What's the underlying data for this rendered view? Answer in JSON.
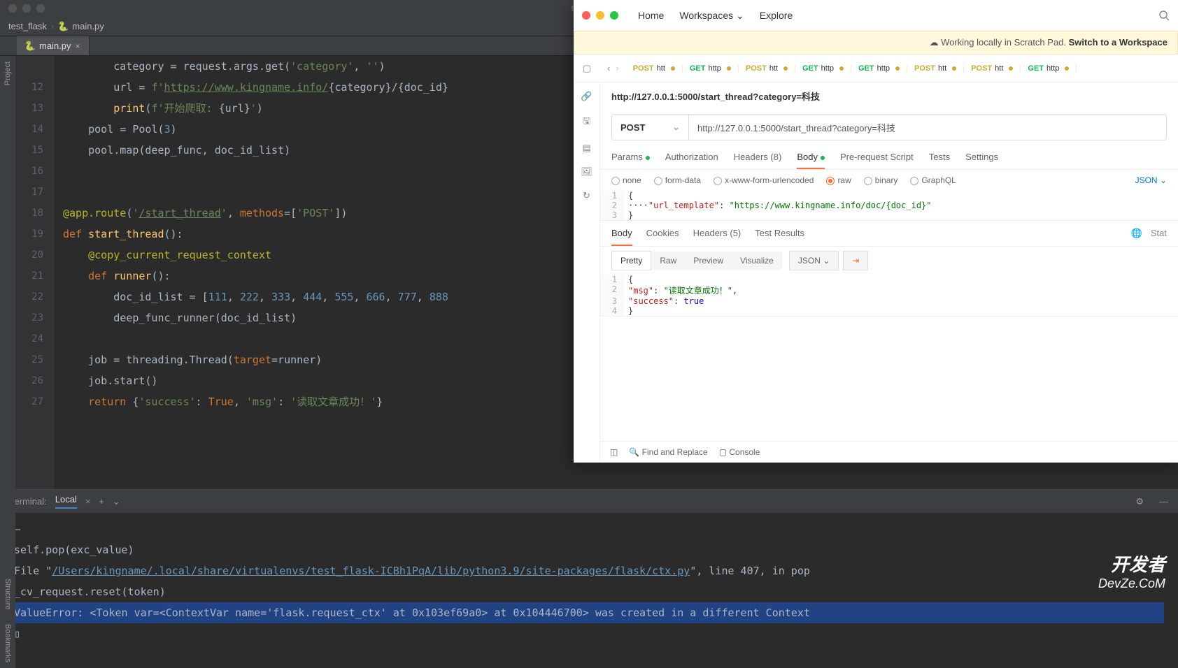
{
  "ide": {
    "title": "test_flask",
    "breadcrumb": {
      "proj": "test_flask",
      "file": "main.py"
    },
    "tab": {
      "file": "main.py"
    },
    "sidebar": {
      "project": "Project",
      "structure": "Structure",
      "bookmarks": "Bookmarks"
    },
    "lines": [
      {
        "n": "",
        "html": "        category = request.args.get(<span class='str'>'category'</span>, <span class='str'>''</span>)"
      },
      {
        "n": "12",
        "html": "        url = <span class='str'>f'</span><span class='link'>https://www.kingname.info/</span><span class='op'>{</span>category<span class='op'>}</span>/<span class='op'>{</span>doc_id<span class='op'>}</span>"
      },
      {
        "n": "13",
        "html": "        <span class='fn'>print</span>(<span class='str'>f'开始爬取: </span><span class='op'>{</span>url<span class='op'>}</span><span class='str'>'</span>)"
      },
      {
        "n": "14",
        "html": "    pool = Pool(<span class='num'>3</span>)"
      },
      {
        "n": "15",
        "html": "    pool.map(deep_func, doc_id_list)"
      },
      {
        "n": "16",
        "html": ""
      },
      {
        "n": "17",
        "html": ""
      },
      {
        "n": "18",
        "html": "<span class='dec'>@app.route</span>(<span class='str'>'</span><span class='link'>/start_thread</span><span class='str'>'</span>, <span class='param'>methods</span>=[<span class='str'>'POST'</span>])"
      },
      {
        "n": "19",
        "html": "<span class='kw'>def </span><span class='fn'>start_thread</span>():"
      },
      {
        "n": "20",
        "html": "    <span class='dec'>@copy_current_request_context</span>"
      },
      {
        "n": "21",
        "html": "    <span class='kw'>def </span><span class='fn'>runner</span>():"
      },
      {
        "n": "22",
        "html": "        doc_id_list = [<span class='num'>111</span>, <span class='num'>222</span>, <span class='num'>333</span>, <span class='num'>444</span>, <span class='num'>555</span>, <span class='num'>666</span>, <span class='num'>777</span>, <span class='num'>888</span>"
      },
      {
        "n": "23",
        "html": "        deep_func_runner(doc_id_list)"
      },
      {
        "n": "24",
        "html": ""
      },
      {
        "n": "25",
        "html": "    job = threading.Thread(<span class='param'>target</span>=runner)"
      },
      {
        "n": "26",
        "html": "    job.start()"
      },
      {
        "n": "27",
        "html": "    <span class='kw'>return </span>{<span class='str'>'success'</span>: <span class='kw'>True</span>, <span class='str'>'msg'</span>: <span class='str'>'读取文章成功！'</span>}"
      }
    ]
  },
  "terminal": {
    "label": "Terminal:",
    "local": "Local",
    "lines": [
      {
        "html": "—"
      },
      {
        "html": "    self.pop(exc_value)"
      },
      {
        "html": "  File \"<span class='filelink'>/Users/kingname/.local/share/virtualenvs/test_flask-ICBh1PqA/lib/python3.9/site-packages/flask/ctx.py</span>\", line 407, in pop"
      },
      {
        "html": "    _cv_request.reset(token)"
      },
      {
        "html": "<span class='err-highlight'>ValueError: &lt;Token var=&lt;ContextVar name='flask.request_ctx' at 0x103ef69a0&gt; at 0x104446700&gt; was created in a different Context</span>"
      },
      {
        "html": "▯"
      }
    ]
  },
  "postman": {
    "nav": {
      "home": "Home",
      "workspaces": "Workspaces",
      "explore": "Explore"
    },
    "banner": {
      "icon": "cloud-off",
      "text": "Working locally in Scratch Pad.",
      "cta": "Switch to a Workspace"
    },
    "reqtabs": [
      {
        "method": "POST",
        "label": "htt"
      },
      {
        "method": "GET",
        "label": "http"
      },
      {
        "method": "POST",
        "label": "htt"
      },
      {
        "method": "GET",
        "label": "http"
      },
      {
        "method": "GET",
        "label": "http"
      },
      {
        "method": "POST",
        "label": "htt"
      },
      {
        "method": "POST",
        "label": "htt"
      },
      {
        "method": "GET",
        "label": "http"
      }
    ],
    "url_display": "http://127.0.0.1:5000/start_thread?category=科技",
    "method": "POST",
    "url_input": "http://127.0.0.1:5000/start_thread?category=科技",
    "subtabs": {
      "params": "Params",
      "auth": "Authorization",
      "headers": "Headers (8)",
      "body": "Body",
      "prereq": "Pre-request Script",
      "tests": "Tests",
      "settings": "Settings"
    },
    "bodytypes": {
      "none": "none",
      "formdata": "form-data",
      "urlenc": "x-www-form-urlencoded",
      "raw": "raw",
      "binary": "binary",
      "graphql": "GraphQL",
      "json": "JSON"
    },
    "req_body_lines": [
      {
        "n": "1",
        "html": "{"
      },
      {
        "n": "2",
        "html": "····<span class='jkey'>\"url_template\"</span>: <span class='jstr'>\"https://www.kingname.info/doc/{doc_id}\"</span>"
      },
      {
        "n": "3",
        "html": "}"
      }
    ],
    "resp_tabs": {
      "body": "Body",
      "cookies": "Cookies",
      "headers": "Headers (5)",
      "tests": "Test Results",
      "status": "Stat"
    },
    "resp_views": {
      "pretty": "Pretty",
      "raw": "Raw",
      "preview": "Preview",
      "visualize": "Visualize",
      "json": "JSON"
    },
    "resp_body_lines": [
      {
        "n": "1",
        "html": "{"
      },
      {
        "n": "2",
        "html": "    <span class='jkey'>\"msg\"</span>: <span class='jstr'>\"读取文章成功！\"</span>,"
      },
      {
        "n": "3",
        "html": "    <span class='jkey'>\"success\"</span>: <span class='jbool'>true</span>"
      },
      {
        "n": "4",
        "html": "}"
      }
    ],
    "footer": {
      "find": "Find and Replace",
      "console": "Console"
    }
  },
  "watermark": {
    "l1": "开发者",
    "l2": "DevZe.CoM"
  }
}
